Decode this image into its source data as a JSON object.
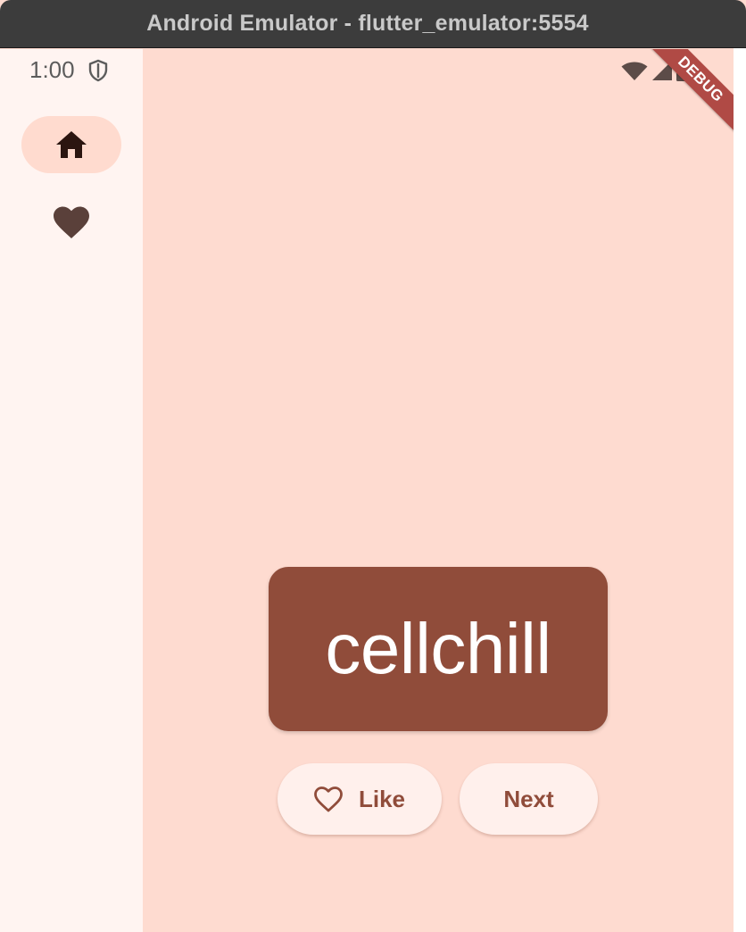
{
  "window": {
    "title": "Android Emulator - flutter_emulator:5554"
  },
  "status_bar": {
    "time": "1:00"
  },
  "debug_banner": {
    "label": "DEBUG"
  },
  "rail": {
    "items": [
      {
        "icon": "home-icon",
        "selected": true
      },
      {
        "icon": "heart-icon",
        "selected": false
      }
    ]
  },
  "main": {
    "word": "cellchill",
    "like_label": "Like",
    "next_label": "Next"
  },
  "colors": {
    "background": "#fedbd0",
    "rail_background": "#fff4f1",
    "selected_indicator": "#ffdbcf",
    "card": "#904c3a",
    "button_background": "#fff0ec",
    "button_text": "#904c3a",
    "debug_banner": "#b04a45"
  }
}
